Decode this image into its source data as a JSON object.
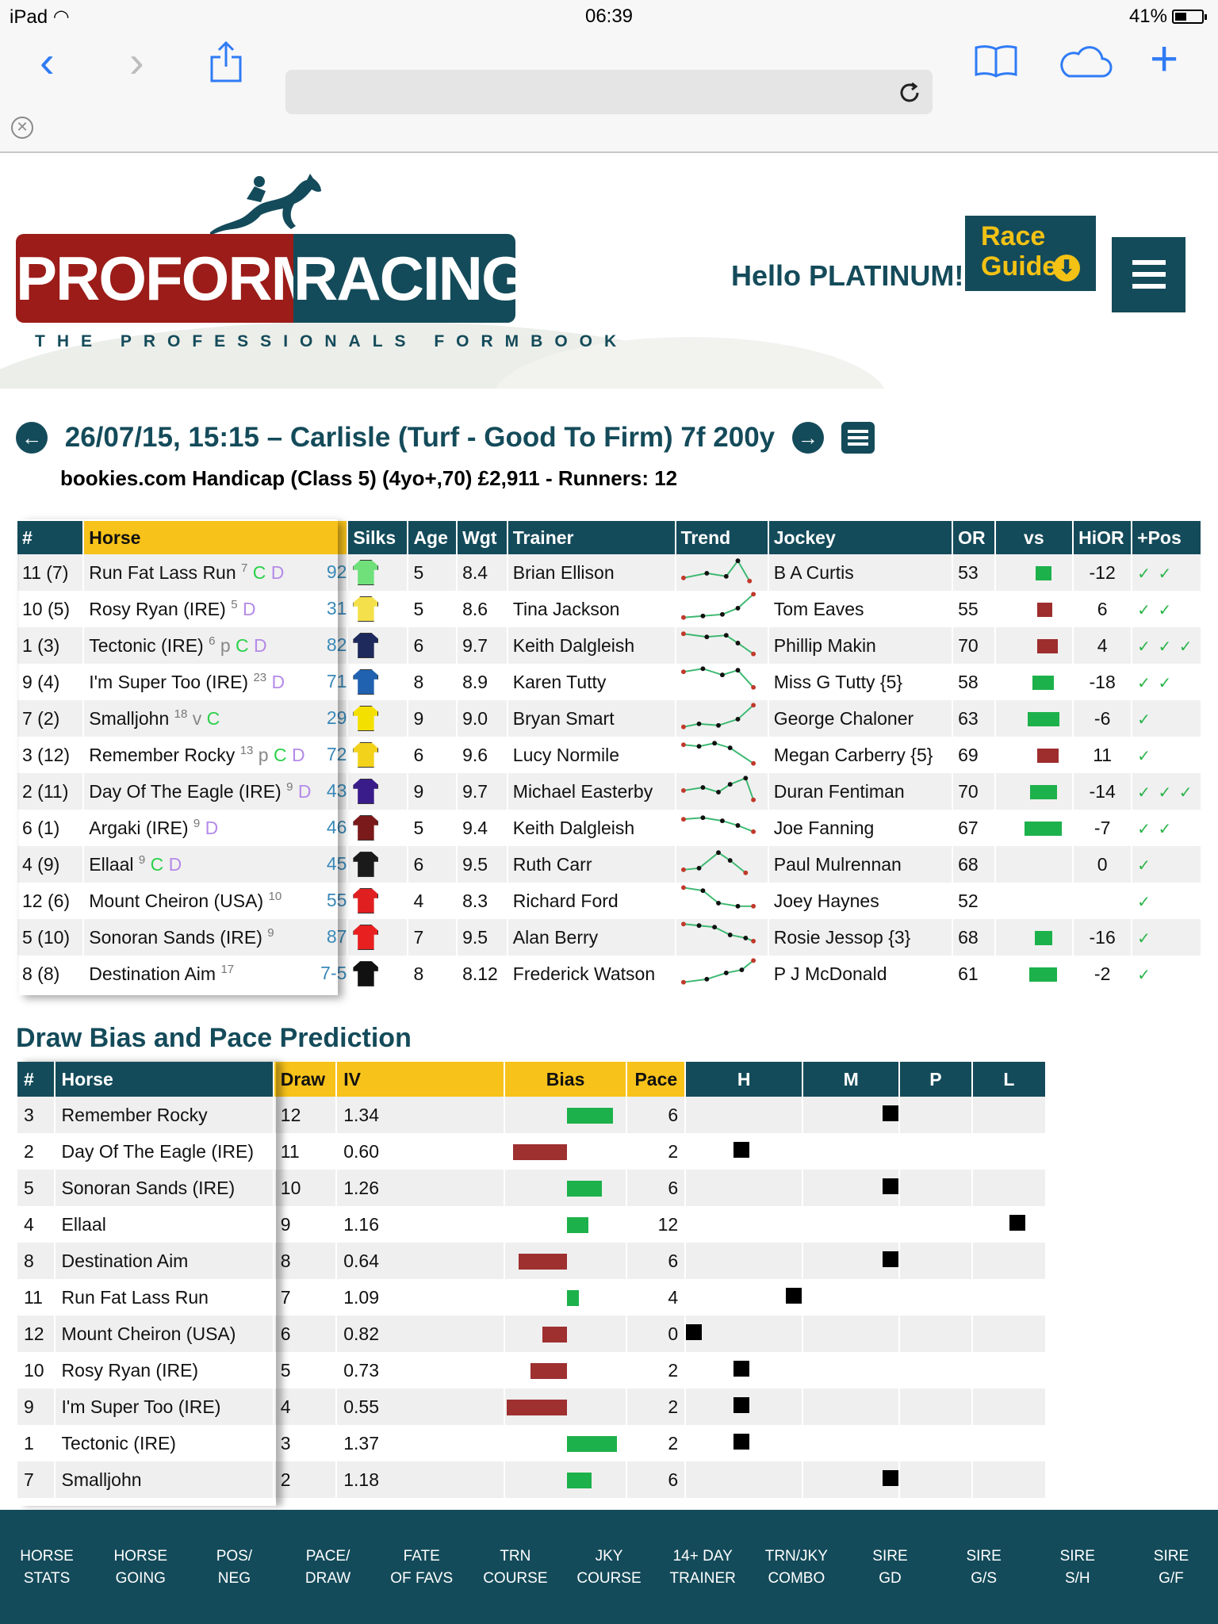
{
  "status": {
    "device": "iPad",
    "time": "06:39",
    "battery": "41%"
  },
  "header": {
    "brand_left": "PROFORM",
    "brand_right": "RACING",
    "tagline": "THE PROFESSIONALS FORMBOOK",
    "greeting": "Hello PLATINUM!",
    "race_guides": "Race Guides",
    "accent_teal": "#144b5a",
    "accent_red": "#9b1c18",
    "accent_gold": "#f3c215"
  },
  "race": {
    "title": "26/07/15, 15:15 – Carlisle (Turf - Good To Firm) 7f 200y",
    "subtitle": "bookies.com Handicap (Class 5) (4yo+,70) £2,911 - Runners: 12"
  },
  "runners": {
    "columns": [
      "#",
      "Horse",
      "Silks",
      "Age",
      "Wgt",
      "Trainer",
      "Trend",
      "Jockey",
      "OR",
      "vs",
      "HiOR",
      "+Pos"
    ],
    "rows": [
      {
        "num": "11 (7)",
        "horse": "Run Fat Lass Run",
        "days": "7",
        "flags": [
          {
            "t": "C",
            "c": "c"
          },
          {
            "t": "D",
            "c": "d"
          }
        ],
        "cut": "92",
        "silk": "#6fe07a",
        "age": "5",
        "wgt": "8.4",
        "trainer": "Brian Ellison",
        "jockey": "B A Curtis",
        "or": "53",
        "vs": 1,
        "hior": "-12",
        "pos": "✓ ✓"
      },
      {
        "num": "10 (5)",
        "horse": "Rosy Ryan (IRE)",
        "days": "5",
        "flags": [
          {
            "t": "D",
            "c": "d"
          }
        ],
        "cut": "31",
        "silk": "#f4e04a",
        "age": "5",
        "wgt": "8.6",
        "trainer": "Tina Jackson",
        "jockey": "Tom Eaves",
        "or": "55",
        "vs": -1,
        "hior": "6",
        "pos": "✓ ✓"
      },
      {
        "num": "1 (3)",
        "horse": "Tectonic (IRE)",
        "days": "6",
        "flags": [
          {
            "t": "p",
            "c": "g"
          },
          {
            "t": "C",
            "c": "c"
          },
          {
            "t": "D",
            "c": "d"
          }
        ],
        "cut": "82",
        "silk": "#1e2a5c",
        "age": "6",
        "wgt": "9.7",
        "trainer": "Keith Dalgleish",
        "jockey": "Phillip Makin",
        "or": "70",
        "vs": -1,
        "hior": "4",
        "pos": "✓ ✓ ✓"
      },
      {
        "num": "9 (4)",
        "horse": "I'm Super Too (IRE)",
        "days": "23",
        "flags": [
          {
            "t": "D",
            "c": "d"
          }
        ],
        "cut": "71",
        "silk": "#2062b0",
        "age": "8",
        "wgt": "8.9",
        "trainer": "Karen Tutty",
        "jockey": "Miss G Tutty {5}",
        "or": "58",
        "vs": 1,
        "hior": "-18",
        "pos": "✓ ✓"
      },
      {
        "num": "7 (2)",
        "horse": "Smalljohn",
        "days": "18",
        "flags": [
          {
            "t": "v",
            "c": "g"
          },
          {
            "t": "C",
            "c": "c"
          }
        ],
        "cut": "29",
        "silk": "#f4e000",
        "age": "9",
        "wgt": "9.0",
        "trainer": "Bryan Smart",
        "jockey": "George Chaloner",
        "or": "63",
        "vs": 1,
        "hior": "-6",
        "pos": "✓"
      },
      {
        "num": "3 (12)",
        "horse": "Remember Rocky",
        "days": "13",
        "flags": [
          {
            "t": "p",
            "c": "g"
          },
          {
            "t": "C",
            "c": "c"
          },
          {
            "t": "D",
            "c": "d"
          }
        ],
        "cut": "72",
        "silk": "#f3d21c",
        "age": "6",
        "wgt": "9.6",
        "trainer": "Lucy Normile",
        "jockey": "Megan Carberry {5}",
        "or": "69",
        "vs": -1,
        "hior": "11",
        "pos": "✓"
      },
      {
        "num": "2 (11)",
        "horse": "Day Of The Eagle (IRE)",
        "days": "9",
        "flags": [
          {
            "t": "D",
            "c": "d"
          }
        ],
        "cut": "43",
        "silk": "#3a1b8a",
        "age": "9",
        "wgt": "9.7",
        "trainer": "Michael Easterby",
        "jockey": "Duran Fentiman",
        "or": "70",
        "vs": 1,
        "hior": "-14",
        "pos": "✓ ✓ ✓"
      },
      {
        "num": "6 (1)",
        "horse": "Argaki (IRE)",
        "days": "9",
        "flags": [
          {
            "t": "D",
            "c": "d"
          }
        ],
        "cut": "46",
        "silk": "#7a1a1a",
        "age": "5",
        "wgt": "9.4",
        "trainer": "Keith Dalgleish",
        "jockey": "Joe Fanning",
        "or": "67",
        "vs": 1,
        "hior": "-7",
        "pos": "✓ ✓"
      },
      {
        "num": "4 (9)",
        "horse": "Ellaal",
        "days": "9",
        "flags": [
          {
            "t": "C",
            "c": "c"
          },
          {
            "t": "D",
            "c": "d"
          }
        ],
        "cut": "45",
        "silk": "#1a1a1a",
        "age": "6",
        "wgt": "9.5",
        "trainer": "Ruth Carr",
        "jockey": "Paul Mulrennan",
        "or": "68",
        "vs": 0,
        "hior": "0",
        "pos": "✓"
      },
      {
        "num": "12 (6)",
        "horse": "Mount Cheiron (USA)",
        "days": "10",
        "flags": [],
        "cut": "55",
        "silk": "#e02020",
        "age": "4",
        "wgt": "8.3",
        "trainer": "Richard Ford",
        "jockey": "Joey Haynes",
        "or": "52",
        "vs": 0,
        "hior": "",
        "pos": "✓"
      },
      {
        "num": "5 (10)",
        "horse": "Sonoran Sands (IRE)",
        "days": "9",
        "flags": [],
        "cut": "87",
        "silk": "#e82020",
        "age": "7",
        "wgt": "9.5",
        "trainer": "Alan Berry",
        "jockey": "Rosie Jessop {3}",
        "or": "68",
        "vs": 1,
        "hior": "-16",
        "pos": "✓"
      },
      {
        "num": "8 (8)",
        "horse": "Destination Aim",
        "days": "17",
        "flags": [],
        "cut": "7-5",
        "silk": "#111111",
        "age": "8",
        "wgt": "8.12",
        "trainer": "Frederick Watson",
        "jockey": "P J McDonald",
        "or": "61",
        "vs": 1,
        "hior": "-2",
        "pos": "✓"
      }
    ]
  },
  "bias": {
    "heading": "Draw Bias and Pace Prediction",
    "columns": [
      "#",
      "Horse",
      "Draw",
      "IV",
      "Bias",
      "Pace",
      "H",
      "M",
      "P",
      "L"
    ],
    "rows": [
      {
        "num": "3",
        "horse": "Remember Rocky",
        "draw": "12",
        "iv": "1.34",
        "pace": "6",
        "cell": "M"
      },
      {
        "num": "2",
        "horse": "Day Of The Eagle (IRE)",
        "draw": "11",
        "iv": "0.60",
        "pace": "2",
        "cell": "H"
      },
      {
        "num": "5",
        "horse": "Sonoran Sands (IRE)",
        "draw": "10",
        "iv": "1.26",
        "pace": "6",
        "cell": "M"
      },
      {
        "num": "4",
        "horse": "Ellaal",
        "draw": "9",
        "iv": "1.16",
        "pace": "12",
        "cell": "L"
      },
      {
        "num": "8",
        "horse": "Destination Aim",
        "draw": "8",
        "iv": "0.64",
        "pace": "6",
        "cell": "M"
      },
      {
        "num": "11",
        "horse": "Run Fat Lass Run",
        "draw": "7",
        "iv": "1.09",
        "pace": "4",
        "cell": "H2"
      },
      {
        "num": "12",
        "horse": "Mount Cheiron (USA)",
        "draw": "6",
        "iv": "0.82",
        "pace": "0",
        "cell": "H0"
      },
      {
        "num": "10",
        "horse": "Rosy Ryan (IRE)",
        "draw": "5",
        "iv": "0.73",
        "pace": "2",
        "cell": "H"
      },
      {
        "num": "9",
        "horse": "I'm Super Too (IRE)",
        "draw": "4",
        "iv": "0.55",
        "pace": "2",
        "cell": "H"
      },
      {
        "num": "1",
        "horse": "Tectonic (IRE)",
        "draw": "3",
        "iv": "1.37",
        "pace": "2",
        "cell": "H"
      },
      {
        "num": "7",
        "horse": "Smalljohn",
        "draw": "2",
        "iv": "1.18",
        "pace": "6",
        "cell": "M"
      }
    ]
  },
  "bottom_nav": [
    [
      "HORSE",
      "STATS"
    ],
    [
      "HORSE",
      "GOING"
    ],
    [
      "POS/",
      "NEG"
    ],
    [
      "PACE/",
      "DRAW"
    ],
    [
      "FATE",
      "OF FAVS"
    ],
    [
      "TRN",
      "COURSE"
    ],
    [
      "JKY",
      "COURSE"
    ],
    [
      "14+ DAY",
      "TRAINER"
    ],
    [
      "TRN/JKY",
      "COMBO"
    ],
    [
      "SIRE",
      "GD"
    ],
    [
      "SIRE",
      "G/S"
    ],
    [
      "SIRE",
      "S/H"
    ],
    [
      "SIRE",
      "G/F"
    ]
  ]
}
